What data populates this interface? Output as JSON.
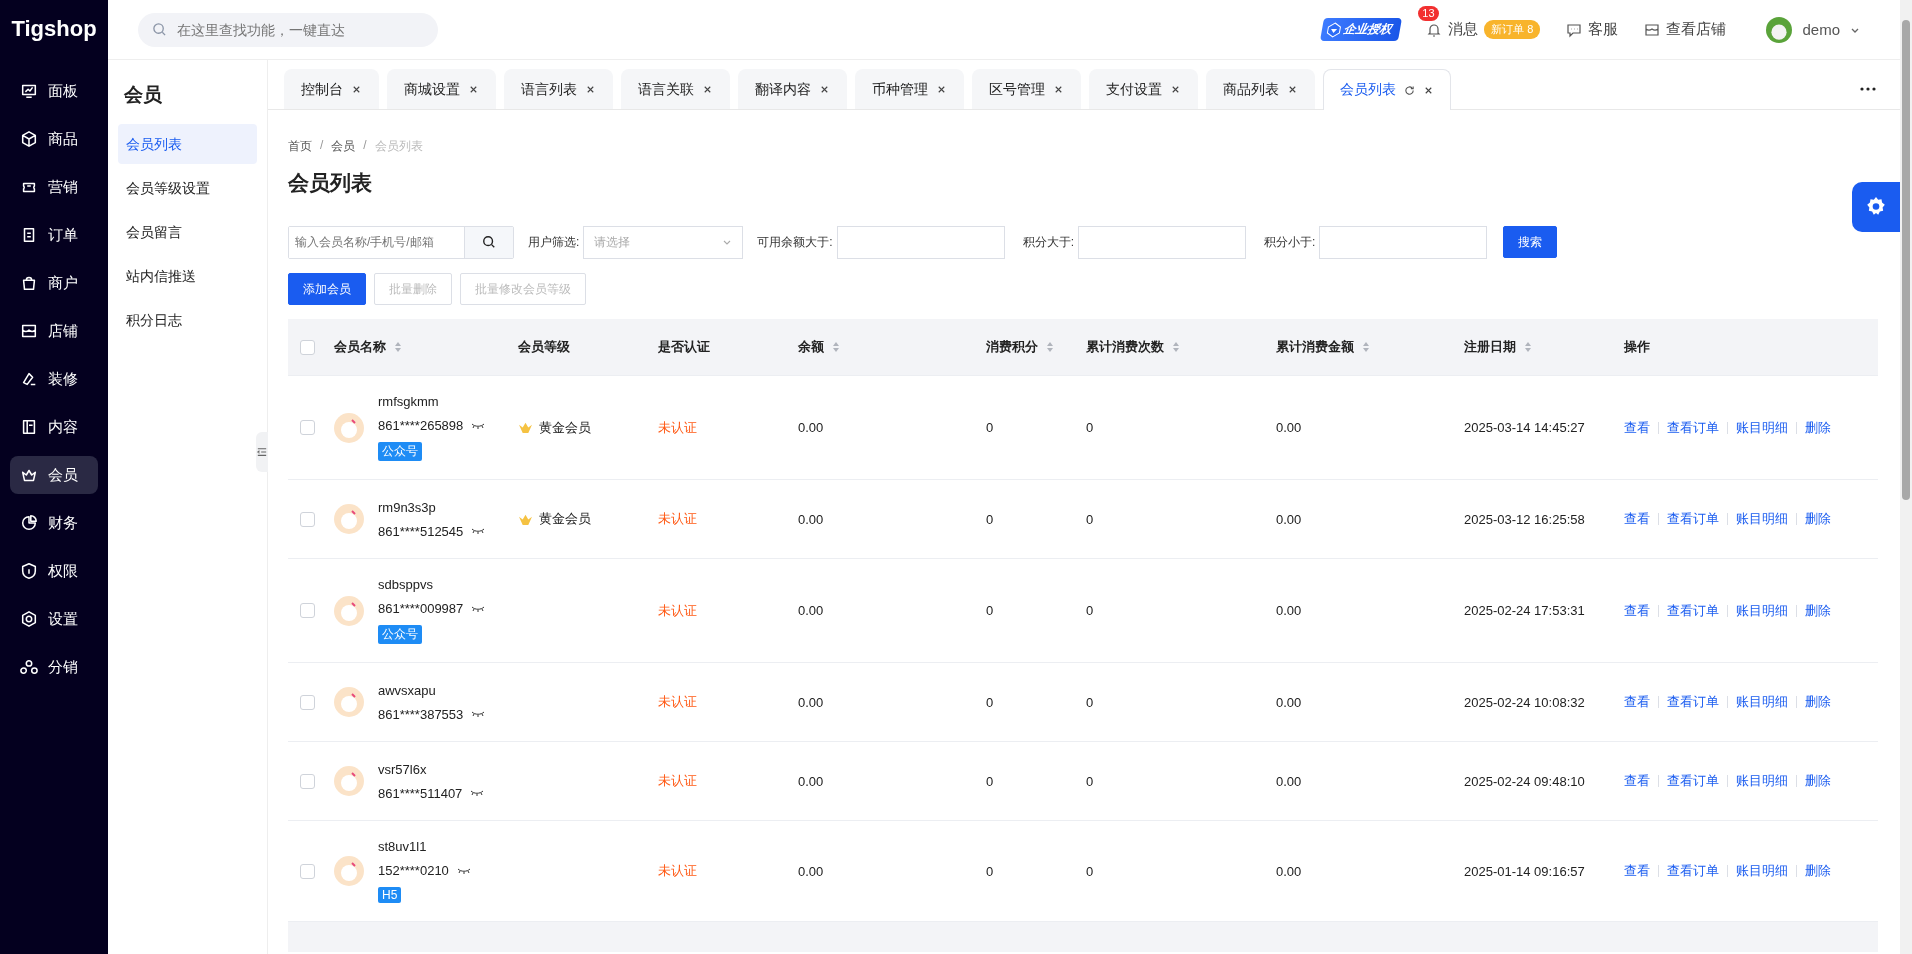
{
  "logo": "Tigshop",
  "search": {
    "placeholder": "在这里查找功能，一键直达"
  },
  "header": {
    "license_badge": "企业授权",
    "notification_count": "13",
    "messages_label": "消息",
    "new_order_badge": "新订单 8",
    "service_label": "客服",
    "store_label": "查看店铺",
    "user_name": "demo"
  },
  "sidebar": {
    "items": [
      {
        "label": "面板",
        "selected": false
      },
      {
        "label": "商品",
        "selected": false
      },
      {
        "label": "营销",
        "selected": false
      },
      {
        "label": "订单",
        "selected": false
      },
      {
        "label": "商户",
        "selected": false
      },
      {
        "label": "店铺",
        "selected": false
      },
      {
        "label": "装修",
        "selected": false
      },
      {
        "label": "内容",
        "selected": false
      },
      {
        "label": "会员",
        "selected": true
      },
      {
        "label": "财务",
        "selected": false
      },
      {
        "label": "权限",
        "selected": false
      },
      {
        "label": "设置",
        "selected": false
      },
      {
        "label": "分销",
        "selected": false
      }
    ]
  },
  "subnav": {
    "title": "会员",
    "items": [
      {
        "label": "会员列表",
        "selected": true
      },
      {
        "label": "会员等级设置",
        "selected": false
      },
      {
        "label": "会员留言",
        "selected": false
      },
      {
        "label": "站内信推送",
        "selected": false
      },
      {
        "label": "积分日志",
        "selected": false
      }
    ]
  },
  "tabs": [
    {
      "label": "控制台",
      "selected": false
    },
    {
      "label": "商城设置",
      "selected": false
    },
    {
      "label": "语言列表",
      "selected": false
    },
    {
      "label": "语言关联",
      "selected": false
    },
    {
      "label": "翻译内容",
      "selected": false
    },
    {
      "label": "币种管理",
      "selected": false
    },
    {
      "label": "区号管理",
      "selected": false
    },
    {
      "label": "支付设置",
      "selected": false
    },
    {
      "label": "商品列表",
      "selected": false
    },
    {
      "label": "会员列表",
      "selected": true
    }
  ],
  "breadcrumb": [
    "首页",
    "会员",
    "会员列表"
  ],
  "breadcrumb_separator": "/",
  "page_title": "会员列表",
  "filters": {
    "keyword_placeholder": "输入会员名称/手机号/邮箱",
    "user_filter_label": "用户筛选:",
    "user_filter_placeholder": "请选择",
    "balance_label": "可用余额大于:",
    "points_min_label": "积分大于:",
    "points_max_label": "积分小于:",
    "search_button": "搜索"
  },
  "actions": [
    {
      "label": "添加会员",
      "disabled": false
    },
    {
      "label": "批量删除",
      "disabled": true
    },
    {
      "label": "批量修改会员等级",
      "disabled": true
    }
  ],
  "table": {
    "header_checked": false,
    "columns": [
      {
        "label": "会员名称",
        "sortable": true
      },
      {
        "label": "会员等级",
        "sortable": false
      },
      {
        "label": "是否认证",
        "sortable": false
      },
      {
        "label": "余额",
        "sortable": true
      },
      {
        "label": "消费积分",
        "sortable": true
      },
      {
        "label": "累计消费次数",
        "sortable": true
      },
      {
        "label": "累计消费金额",
        "sortable": true
      },
      {
        "label": "注册日期",
        "sortable": true
      },
      {
        "label": "操作",
        "sortable": false
      }
    ],
    "rows": [
      {
        "checked": false,
        "name": "rmfsgkmm",
        "phone": "861****265898",
        "tag": "公众号",
        "level": "黄金会员",
        "verified": "未认证",
        "balance": "0.00",
        "points": "0",
        "orders": "0",
        "spent": "0.00",
        "registered": "2025-03-14 14:45:27",
        "links": [
          "查看",
          "查看订单",
          "账目明细",
          "删除"
        ]
      },
      {
        "checked": false,
        "name": "rm9n3s3p",
        "phone": "861****512545",
        "level": "黄金会员",
        "verified": "未认证",
        "balance": "0.00",
        "points": "0",
        "orders": "0",
        "spent": "0.00",
        "registered": "2025-03-12 16:25:58",
        "links": [
          "查看",
          "查看订单",
          "账目明细",
          "删除"
        ]
      },
      {
        "checked": false,
        "name": "sdbsppvs",
        "phone": "861****009987",
        "tag": "公众号",
        "verified": "未认证",
        "balance": "0.00",
        "points": "0",
        "orders": "0",
        "spent": "0.00",
        "registered": "2025-02-24 17:53:31",
        "links": [
          "查看",
          "查看订单",
          "账目明细",
          "删除"
        ]
      },
      {
        "checked": false,
        "name": "awvsxapu",
        "phone": "861****387553",
        "verified": "未认证",
        "balance": "0.00",
        "points": "0",
        "orders": "0",
        "spent": "0.00",
        "registered": "2025-02-24 10:08:32",
        "links": [
          "查看",
          "查看订单",
          "账目明细",
          "删除"
        ]
      },
      {
        "checked": false,
        "name": "vsr57l6x",
        "phone": "861****511407",
        "verified": "未认证",
        "balance": "0.00",
        "points": "0",
        "orders": "0",
        "spent": "0.00",
        "registered": "2025-02-24 09:48:10",
        "links": [
          "查看",
          "查看订单",
          "账目明细",
          "删除"
        ]
      },
      {
        "checked": false,
        "name": "st8uv1l1",
        "phone": "152****0210",
        "tag": "H5",
        "verified": "未认证",
        "balance": "0.00",
        "points": "0",
        "orders": "0",
        "spent": "0.00",
        "registered": "2025-01-14 09:16:57",
        "links": [
          "查看",
          "查看订单",
          "账目明细",
          "删除"
        ]
      }
    ]
  }
}
